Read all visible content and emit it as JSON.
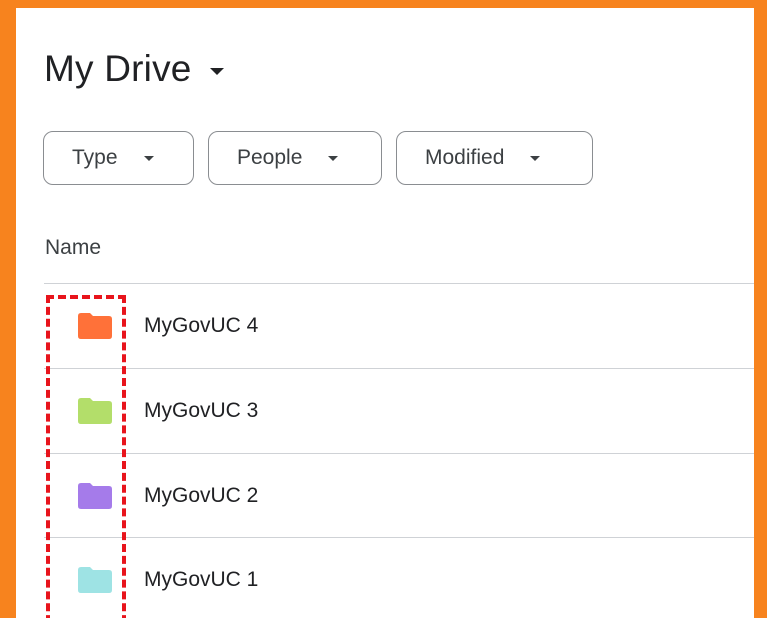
{
  "header": {
    "title": "My Drive"
  },
  "filters": [
    {
      "label": "Type"
    },
    {
      "label": "People"
    },
    {
      "label": "Modified"
    }
  ],
  "list": {
    "column_name": "Name",
    "items": [
      {
        "name": "MyGovUC 4",
        "folder_color": "#ff7139"
      },
      {
        "name": "MyGovUC 3",
        "folder_color": "#b3de6a"
      },
      {
        "name": "MyGovUC 2",
        "folder_color": "#a57bea"
      },
      {
        "name": "MyGovUC 1",
        "folder_color": "#9ee3e4"
      }
    ]
  },
  "colors": {
    "frame_orange": "#f7831e",
    "highlight_dash": "#e8141c"
  }
}
